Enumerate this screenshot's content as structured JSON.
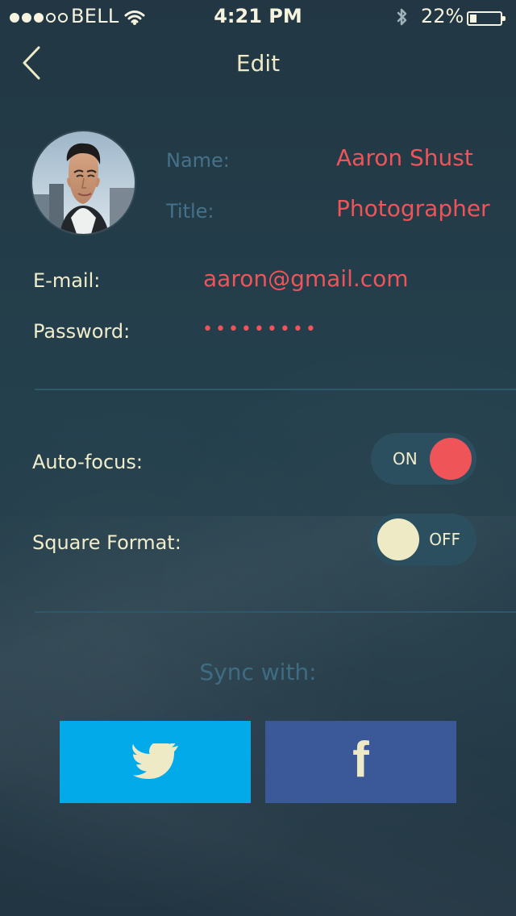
{
  "status_bar": {
    "carrier": "BELL",
    "time": "4:21 PM",
    "battery": "22%",
    "battery_level": 0.22,
    "signal_strength": 3,
    "signal_total": 5
  },
  "header": {
    "back_icon": "chevron-left-icon",
    "title": "Edit"
  },
  "profile": {
    "avatar_icon": "profile-photo",
    "name_label": "Name:",
    "name_value": "Aaron Shust",
    "title_label": "Title:",
    "title_value": "Photographer",
    "email_label": "E-mail:",
    "email_value": "aaron@gmail.com",
    "password_label": "Password:",
    "password_value": "•••••••••"
  },
  "settings": {
    "autofocus_label": "Auto-focus:",
    "autofocus_state": "ON",
    "square_format_label": "Square Format:",
    "square_format_state": "OFF"
  },
  "sync": {
    "label": "Sync with:",
    "twitter_icon": "twitter-icon",
    "facebook_icon": "facebook-icon",
    "facebook_glyph": "f"
  },
  "colors": {
    "background": "#223743",
    "accent_red": "#ef5459",
    "text_cream": "#efeac6",
    "muted_blue": "#46718a",
    "twitter_blue": "#03aaea",
    "facebook_blue": "#3b5998"
  }
}
